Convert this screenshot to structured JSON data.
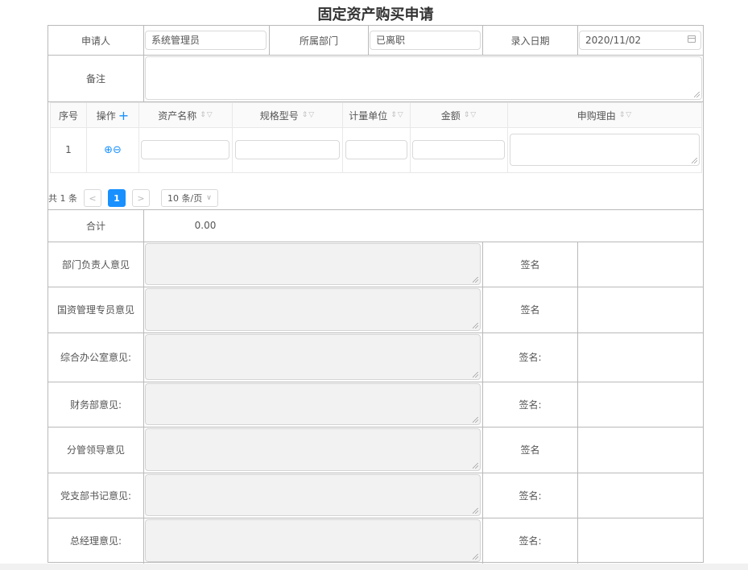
{
  "title": "固定资产购买申请",
  "header": {
    "applicant_label": "申请人",
    "applicant_value": "系统管理员",
    "dept_label": "所属部门",
    "dept_value": "已离职",
    "date_label": "录入日期",
    "date_value": "2020/11/02",
    "remark_label": "备注"
  },
  "grid": {
    "columns": [
      "序号",
      "操作",
      "资产名称",
      "规格型号",
      "计量单位",
      "金额",
      "申购理由"
    ],
    "rows": [
      {
        "index": "1"
      }
    ],
    "sort_icon": "sort-filter-icon"
  },
  "pager": {
    "total": "共 1 条",
    "prev": "<",
    "current": "1",
    "next": ">",
    "page_size": "10 条/页"
  },
  "total": {
    "label": "合计",
    "value": "0.00"
  },
  "opinions": [
    {
      "label": "部门负责人意见",
      "sign": "签名"
    },
    {
      "label": "国资管理专员意见",
      "sign": "签名"
    },
    {
      "label": "综合办公室意见:",
      "sign": "签名:"
    },
    {
      "label": "财务部意见:",
      "sign": "签名:"
    },
    {
      "label": "分管领导意见",
      "sign": "签名"
    },
    {
      "label": "党支部书记意见:",
      "sign": "签名:"
    },
    {
      "label": "总经理意见:",
      "sign": "签名:"
    }
  ]
}
